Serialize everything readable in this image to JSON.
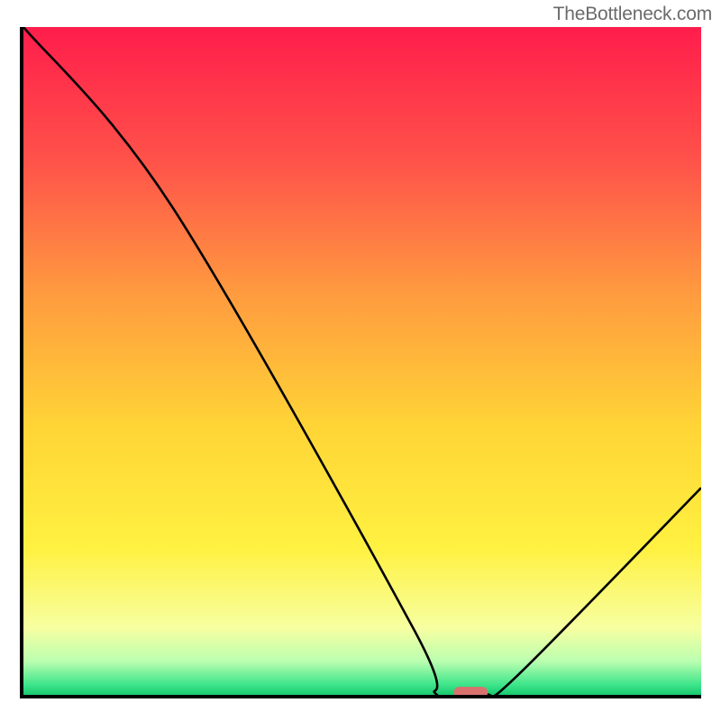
{
  "watermark": "TheBottleneck.com",
  "chart_data": {
    "type": "line",
    "title": "",
    "xlabel": "",
    "ylabel": "",
    "xlim": [
      0,
      100
    ],
    "ylim": [
      0,
      100
    ],
    "series": [
      {
        "name": "curve",
        "x": [
          0,
          22,
          57.5,
          61,
          68,
          73,
          100
        ],
        "values": [
          100,
          73,
          10,
          0,
          0,
          3,
          31
        ]
      }
    ],
    "marker": {
      "x": 66,
      "y": 0,
      "color": "#d9726e"
    },
    "gradient_stops": [
      {
        "pos": 0.0,
        "color": "#ff1d4b"
      },
      {
        "pos": 0.2,
        "color": "#ff524a"
      },
      {
        "pos": 0.4,
        "color": "#ff9b3f"
      },
      {
        "pos": 0.6,
        "color": "#ffd536"
      },
      {
        "pos": 0.78,
        "color": "#fff141"
      },
      {
        "pos": 0.9,
        "color": "#f7ffa1"
      },
      {
        "pos": 0.95,
        "color": "#baffb0"
      },
      {
        "pos": 0.985,
        "color": "#3de58a"
      },
      {
        "pos": 1.0,
        "color": "#19c96f"
      }
    ]
  }
}
